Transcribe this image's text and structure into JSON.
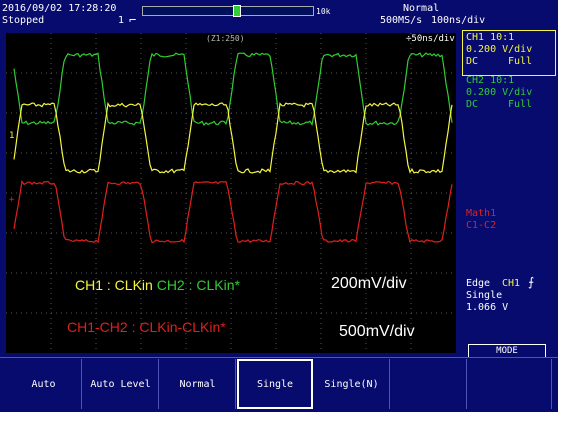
{
  "header": {
    "datetime": "2016/09/02 17:28:20",
    "status": "Stopped",
    "acq_count": "1",
    "trigger_mode": "Normal",
    "sample_rate": "500MS/s",
    "timebase": "100ns/div",
    "record_length": "10k",
    "zoom_label": "(Z1:250)",
    "zoom_timebase": "÷50ns/div"
  },
  "overlay": {
    "line1_ch1": "CH1 : CLKin",
    "line1_ch2": "CH2 : CLKin*",
    "line1_scale": "200mV/div",
    "line2_math": "CH1-CH2 : CLKin-CLKin*",
    "line2_scale": "500mV/div"
  },
  "right_panel": {
    "ch1": {
      "title": "CH1 10:1",
      "scale": "0.200 V/div",
      "coupling": "DC",
      "bandwidth": "Full"
    },
    "ch2": {
      "title": "CH2 10:1",
      "scale": "0.200 V/div",
      "coupling": "DC",
      "bandwidth": "Full"
    },
    "math": {
      "title": "Math1",
      "expr": "C1-C2"
    },
    "trigger": {
      "type": "Edge",
      "source": "CH1",
      "mode": "Single",
      "level": "1.066 V"
    },
    "mode_label": "MODE"
  },
  "softkeys": [
    "Auto",
    "Auto Level",
    "Normal",
    "Single",
    "Single(N)"
  ],
  "colors": {
    "background": "#070b6e",
    "screen": "#000000",
    "ch1": "#f5f542",
    "ch2": "#33cc33",
    "math": "#e0201c",
    "text": "#ffffff"
  }
}
